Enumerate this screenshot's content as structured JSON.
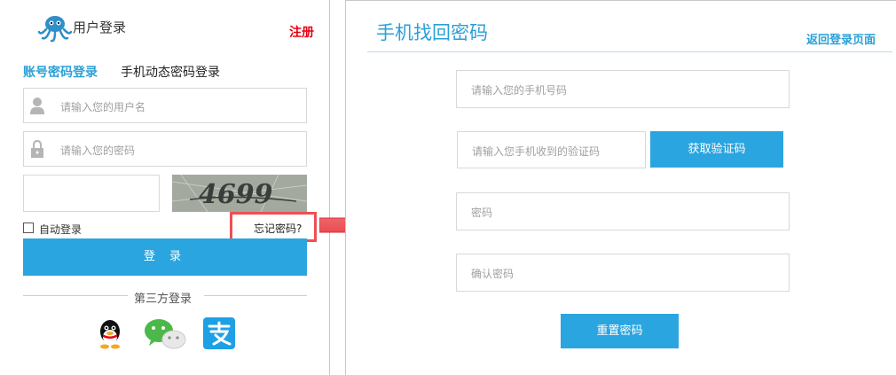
{
  "login": {
    "title": "用户登录",
    "register": "注册",
    "tabs": [
      "账号密码登录",
      "手机动态密码登录"
    ],
    "username_placeholder": "请输入您的用户名",
    "password_placeholder": "请输入您的密码",
    "captcha_text": "4699",
    "auto_login": "自动登录",
    "forgot_password": "忘记密码?",
    "login_button": "登 录",
    "third_party": "第三方登录",
    "social_icons": [
      "qq-icon",
      "wechat-icon",
      "alipay-icon"
    ]
  },
  "reset": {
    "title": "手机找回密码",
    "back_link": "返回登录页面",
    "phone_placeholder": "请输入您的手机号码",
    "code_placeholder": "请输入您手机收到的验证码",
    "get_code_button": "获取验证码",
    "password_placeholder": "密码",
    "confirm_placeholder": "确认密码",
    "reset_button": "重置密码"
  },
  "colors": {
    "accent": "#2ba5e0",
    "register_red": "#e60012",
    "highlight_red": "#ee4f54"
  }
}
